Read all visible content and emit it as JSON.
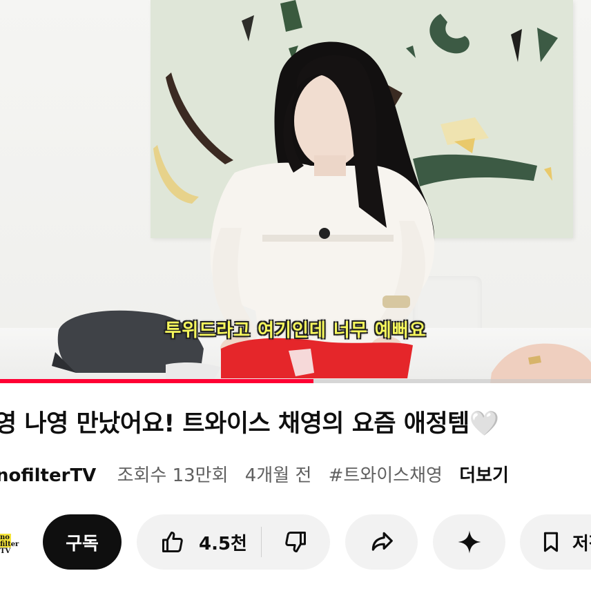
{
  "video": {
    "subtitle": "투위드라고 여기인데 너무 예뻐요",
    "progress": 0.53,
    "accent_color": "#ff0033"
  },
  "title": "영 나영 만났어요! 트와이스 채영의 요즘 애정템🤍",
  "meta": {
    "channel": "nofilterTV",
    "views": "조회수 13만회",
    "age": "4개월 전",
    "hashtag": "#트와이스채영",
    "more": "더보기"
  },
  "actions": {
    "subscribe": "구독",
    "like_count": "4.5천",
    "like_icon": "thumb-up-icon",
    "dislike_icon": "thumb-down-icon",
    "share_icon": "share-icon",
    "remix_icon": "sparkle-icon",
    "save_icon": "bookmark-icon",
    "save_label": "저장"
  },
  "channel_avatar": {
    "logo_text": "no filter TV",
    "logo_color": "#f5e43a"
  }
}
